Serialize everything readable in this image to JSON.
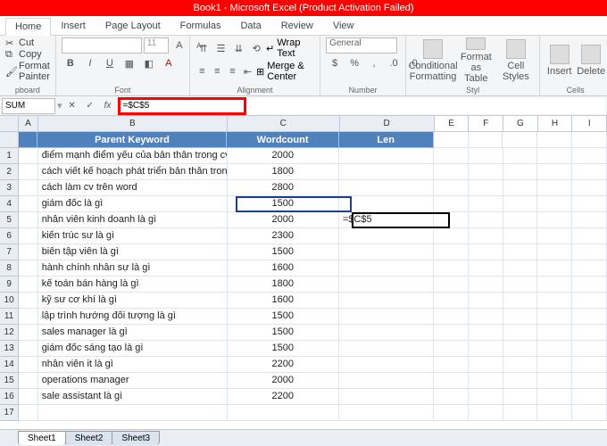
{
  "title": "Book1 - Microsoft Excel (Product Activation Failed)",
  "tabs": [
    "Home",
    "Insert",
    "Page Layout",
    "Formulas",
    "Data",
    "Review",
    "View"
  ],
  "clipboard": {
    "cut": "Cut",
    "copy": "Copy",
    "painter": "Format Painter",
    "label": "pboard"
  },
  "font": {
    "sizeSel": "11",
    "label": "Font",
    "bold": "B",
    "italic": "I",
    "underline": "U"
  },
  "alignment": {
    "wrap": "Wrap Text",
    "merge": "Merge & Center",
    "label": "Alignment"
  },
  "number": {
    "format": "General",
    "label": "Number"
  },
  "styles": {
    "cond": "Conditional Formatting",
    "fmt": "Format as Table",
    "cell": "Cell Styles",
    "label": "Styl"
  },
  "cells": {
    "insert": "Insert",
    "delete": "Delete",
    "label": "Cells"
  },
  "namebox": "SUM",
  "fx_cancel": "✕",
  "fx_enter": "✓",
  "fx_label": "fx",
  "formula": "=$C$5",
  "columns": [
    "A",
    "B",
    "C",
    "D",
    "E",
    "F",
    "G",
    "H",
    "I"
  ],
  "headers": {
    "B": "Parent Keyword",
    "C": "Wordcount",
    "D": "Len"
  },
  "rows": [
    {
      "n": 1,
      "b": "điểm mạnh điểm yếu của bản thân trong cv",
      "c": "2000"
    },
    {
      "n": 2,
      "b": "cách viết kế hoạch phát triển bản thân trong cv",
      "c": "1800"
    },
    {
      "n": 3,
      "b": "cách làm cv trên word",
      "c": "2800"
    },
    {
      "n": 4,
      "b": "giám đốc là gì",
      "c": "1500"
    },
    {
      "n": 5,
      "b": "nhân viên kinh doanh là gì",
      "c": "2000",
      "d": "=$C$5"
    },
    {
      "n": 6,
      "b": "kiến trúc sư là gì",
      "c": "2300"
    },
    {
      "n": 7,
      "b": "biên tập viên là gì",
      "c": "1500"
    },
    {
      "n": 8,
      "b": "hành chính nhân sự là gì",
      "c": "1600"
    },
    {
      "n": 9,
      "b": "kế toán bán hàng là gì",
      "c": "1800"
    },
    {
      "n": 10,
      "b": "kỹ sư cơ khí là gì",
      "c": "1600"
    },
    {
      "n": 11,
      "b": "lập trình hướng đối tượng là gì",
      "c": "1500"
    },
    {
      "n": 12,
      "b": "sales manager là gì",
      "c": "1500"
    },
    {
      "n": 13,
      "b": "giám đốc sáng tạo là gì",
      "c": "1500"
    },
    {
      "n": 14,
      "b": "nhân viên it là gì",
      "c": "2200"
    },
    {
      "n": 15,
      "b": "operations manager",
      "c": "2000"
    },
    {
      "n": 16,
      "b": "sale assistant là gì",
      "c": "2200"
    },
    {
      "n": 17,
      "b": "",
      "c": ""
    }
  ],
  "sheets": [
    "Sheet1",
    "Sheet2",
    "Sheet3"
  ]
}
